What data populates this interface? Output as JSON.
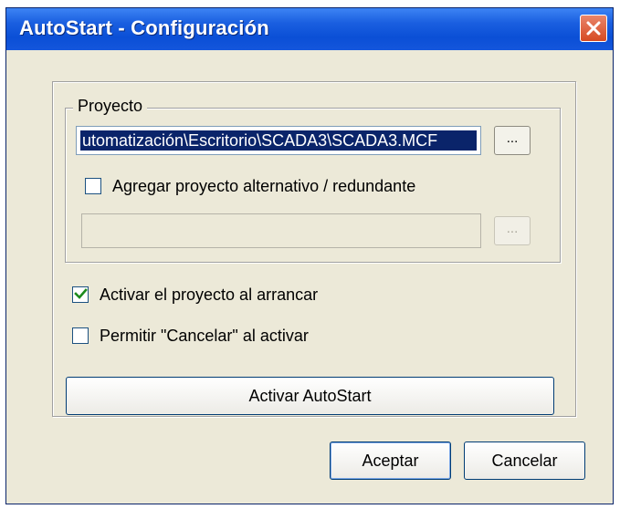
{
  "window": {
    "title": "AutoStart - Configuración",
    "close_icon": "close-icon"
  },
  "project_group": {
    "legend": "Proyecto",
    "path_value": "utomatización\\Escritorio\\SCADA3\\SCADA3.MCF",
    "browse_label": "...",
    "alt_checkbox": {
      "label": "Agregar proyecto alternativo / redundante",
      "checked": false
    },
    "alt_path_value": "",
    "alt_browse_label": "..."
  },
  "options": {
    "activate_on_start": {
      "label": "Activar el proyecto al arrancar",
      "checked": true
    },
    "allow_cancel": {
      "label": "Permitir \"Cancelar\" al activar",
      "checked": false
    }
  },
  "buttons": {
    "activate_autostart": "Activar AutoStart",
    "accept": "Aceptar",
    "cancel": "Cancelar"
  },
  "colors": {
    "titlebar": "#0b4fd6",
    "close_button": "#d64a22",
    "dialog_bg": "#ece9d8",
    "selection": "#0a246a"
  }
}
